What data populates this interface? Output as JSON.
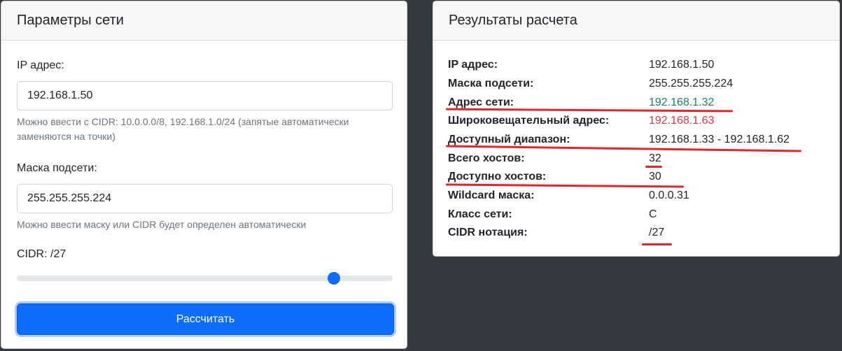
{
  "params": {
    "title": "Параметры сети",
    "ip_label": "IP адрес:",
    "ip_value": "192.168.1.50",
    "ip_help": "Можно ввести с CIDR: 10.0.0.0/8, 192.168.1.0/24 (запятые автоматически заменяются на точки)",
    "mask_label": "Маска подсети:",
    "mask_value": "255.255.255.224",
    "mask_help": "Можно ввести маску или CIDR будет определен автоматически",
    "cidr_label": "CIDR: /27",
    "slider": {
      "value": 27,
      "max": 32
    },
    "calc_button": "Рассчитать"
  },
  "results": {
    "title": "Результаты расчета",
    "rows": [
      {
        "key": "IP адрес:",
        "value": "192.168.1.50",
        "color": "default"
      },
      {
        "key": "Маска подсети:",
        "value": "255.255.255.224",
        "color": "default"
      },
      {
        "key": "Адрес сети:",
        "value": "192.168.1.32",
        "color": "green"
      },
      {
        "key": "Широковещательный адрес:",
        "value": "192.168.1.63",
        "color": "red"
      },
      {
        "key": "Доступный диапазон:",
        "value": "192.168.1.33 - 192.168.1.62",
        "color": "default"
      },
      {
        "key": "Всего хостов:",
        "value": "32",
        "color": "default"
      },
      {
        "key": "Доступно хостов:",
        "value": "30",
        "color": "default"
      },
      {
        "key": "Wildcard маска:",
        "value": "0.0.0.31",
        "color": "default"
      },
      {
        "key": "Класс сети:",
        "value": "C",
        "color": "default"
      },
      {
        "key": "CIDR нотация:",
        "value": "/27",
        "color": "default"
      }
    ]
  },
  "colors": {
    "background": "#343a40",
    "primary": "#0d6efd",
    "green": "#198754",
    "red": "#dc3545",
    "annotation_underline": "#e0262a"
  }
}
